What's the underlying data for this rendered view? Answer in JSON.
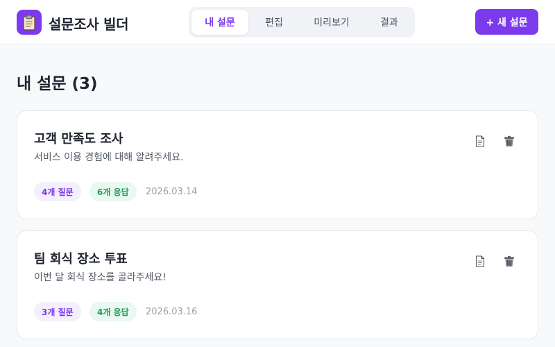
{
  "header": {
    "logo_icon": "clipboard-icon",
    "title": "설문조사 빌더",
    "tabs": [
      {
        "label": "내 설문",
        "active": true
      },
      {
        "label": "편집",
        "active": false
      },
      {
        "label": "미리보기",
        "active": false
      },
      {
        "label": "결과",
        "active": false
      }
    ],
    "new_button": "+ 새 설문"
  },
  "main": {
    "title": "내 설문 (3)",
    "surveys": [
      {
        "title": "고객 만족도 조사",
        "description": "서비스 이용 경험에 대해 알려주세요.",
        "questions": "4개 질문",
        "responses": "6개 응답",
        "date": "2026.03.14"
      },
      {
        "title": "팀 회식 장소 투표",
        "description": "이번 달 회식 장소를 골라주세요!",
        "questions": "3개 질문",
        "responses": "4개 응답",
        "date": "2026.03.16"
      }
    ]
  },
  "colors": {
    "accent": "#7c3aed",
    "success": "#1f9d5b"
  }
}
